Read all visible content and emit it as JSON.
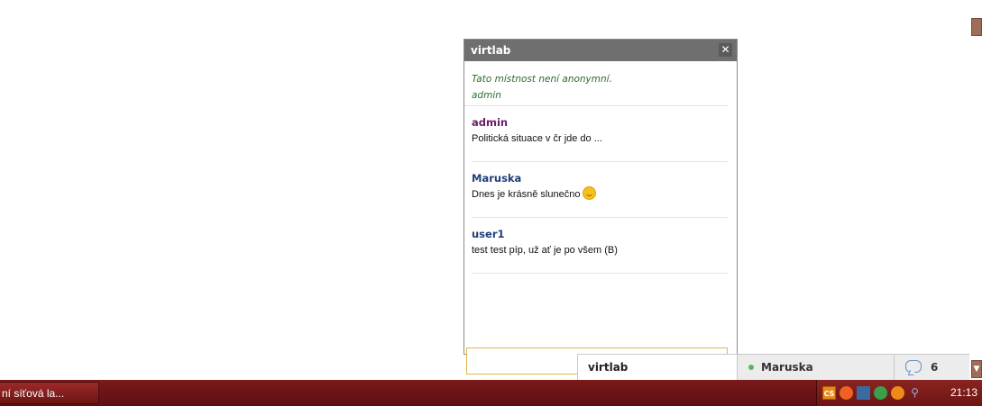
{
  "chat_window": {
    "title": "virtlab",
    "close_symbol": "✕",
    "notice_lines": [
      "Tato místnost není anonymní.",
      "admin"
    ],
    "messages": [
      {
        "author": "admin",
        "author_color": "#6b1b6b",
        "text": "Politická situace v čr jde do ...",
        "emoticon": false
      },
      {
        "author": "Maruska",
        "author_color": "#1f3f7a",
        "text": "Dnes je krásně slunečno",
        "emoticon": true
      },
      {
        "author": "user1",
        "author_color": "#1f3f7a",
        "text": "test test píp, už ať je po všem (B)",
        "emoticon": false
      }
    ],
    "input_value": ""
  },
  "chat_bar": {
    "active_tab": "virtlab",
    "online_user": "Maruska",
    "online_count": "6"
  },
  "taskbar": {
    "task_label": "ní síťová la...",
    "tray_cs": "CS",
    "clock": "21:13"
  },
  "colors": {
    "header_bg": "#6f6f6f",
    "notice_text": "#2e6b2e",
    "taskbar_bg": "#6b1513",
    "online_dot": "#5fb35f"
  },
  "icons": [
    "close-icon",
    "smile-emoticon-icon",
    "online-status-icon",
    "chat-bubble-icon"
  ]
}
